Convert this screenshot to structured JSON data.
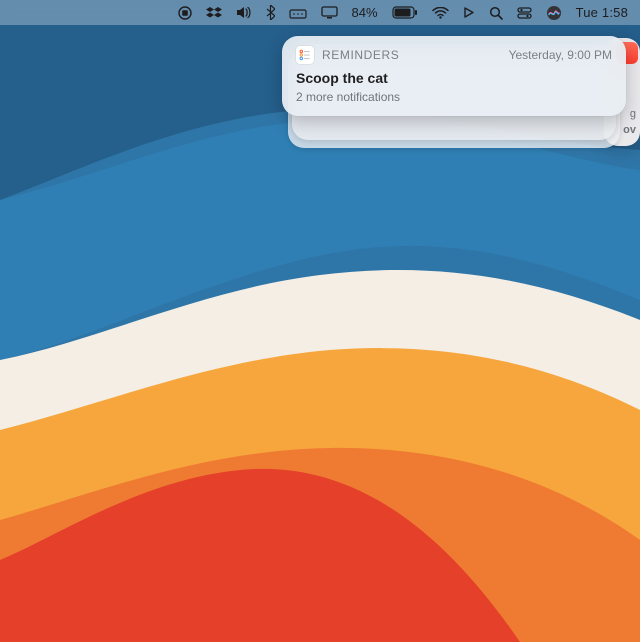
{
  "menubar": {
    "battery_percent": "84%",
    "clock": "Tue 1:58"
  },
  "widget_peek": {
    "line1": "g",
    "line2": "ov"
  },
  "notification": {
    "app_name": "REMINDERS",
    "timestamp": "Yesterday, 9:00 PM",
    "title": "Scoop the cat",
    "subtitle": "2 more notifications"
  }
}
